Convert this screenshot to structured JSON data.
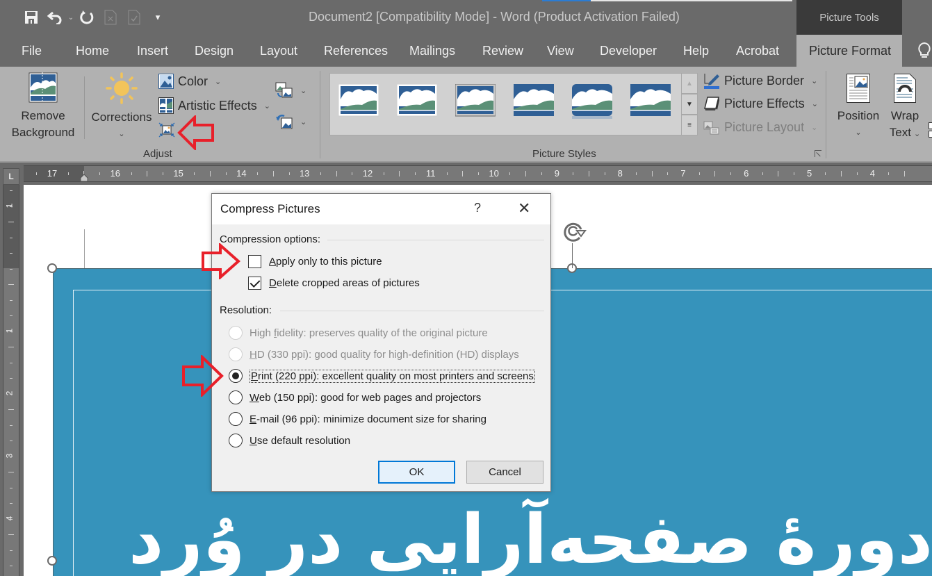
{
  "window": {
    "title": "Document2 [Compatibility Mode]  -  Word (Product Activation Failed)",
    "context_header": "Picture Tools",
    "quick_access": [
      {
        "icon": "save-icon",
        "glyph": "💾"
      },
      {
        "icon": "undo-icon",
        "glyph": "↶"
      },
      {
        "icon": "redo-icon",
        "glyph": "↻"
      },
      {
        "icon": "document-x-icon",
        "glyph": "🗋"
      },
      {
        "icon": "document-check-icon",
        "glyph": "🗋"
      },
      {
        "icon": "customize-qat-icon",
        "glyph": "▾"
      }
    ],
    "accent_color": "#2b7cd3"
  },
  "tabs": [
    {
      "label": "File"
    },
    {
      "label": "Home"
    },
    {
      "label": "Insert"
    },
    {
      "label": "Design"
    },
    {
      "label": "Layout"
    },
    {
      "label": "References"
    },
    {
      "label": "Mailings"
    },
    {
      "label": "Review"
    },
    {
      "label": "View"
    },
    {
      "label": "Developer"
    },
    {
      "label": "Help"
    },
    {
      "label": "Acrobat"
    },
    {
      "label": "Picture Format",
      "active": true
    }
  ],
  "ribbon": {
    "adjust": {
      "label": "Adjust",
      "remove_background_line1": "Remove",
      "remove_background_line2": "Background",
      "corrections": "Corrections",
      "color": "Color",
      "artistic_effects": "Artistic Effects"
    },
    "picture_styles": {
      "label": "Picture Styles",
      "picture_border": "Picture Border",
      "picture_effects": "Picture Effects",
      "picture_layout": "Picture Layout"
    },
    "arrange": {
      "position": "Position",
      "wrap_line1": "Wrap",
      "wrap_line2": "Text"
    }
  },
  "ruler": {
    "horizontal": [
      "17",
      "16",
      "15",
      "14",
      "13",
      "12",
      "11",
      "10",
      "9",
      "8",
      "7",
      "6",
      "5",
      "4"
    ],
    "vertical": [
      "1",
      "1",
      "2",
      "3",
      "4"
    ]
  },
  "document": {
    "heading": "دورهٔ صفحه‌آرایی در وُرد",
    "picture_color": "#3693bb"
  },
  "dialog": {
    "title": "Compress Pictures",
    "help": "?",
    "close": "✕",
    "compression_label": "Compression options:",
    "options": [
      {
        "pre": "",
        "u": "A",
        "post": "pply only to this picture",
        "checked": false
      },
      {
        "pre": "",
        "u": "D",
        "post": "elete cropped areas of pictures",
        "checked": true
      }
    ],
    "resolution_label": "Resolution:",
    "resolutions": [
      {
        "pre": "High ",
        "u": "f",
        "post": "idelity: preserves quality of the original picture",
        "disabled": true,
        "selected": false
      },
      {
        "pre": "",
        "u": "H",
        "post": "D (330 ppi): good quality for high-definition (HD) displays",
        "disabled": true,
        "selected": false
      },
      {
        "pre": "",
        "u": "P",
        "post": "rint (220 ppi): excellent quality on most printers and screens",
        "disabled": false,
        "selected": true
      },
      {
        "pre": "",
        "u": "W",
        "post": "eb (150 ppi): good for web pages and projectors",
        "disabled": false,
        "selected": false
      },
      {
        "pre": "",
        "u": "E",
        "post": "-mail (96 ppi): minimize document size for sharing",
        "disabled": false,
        "selected": false
      },
      {
        "pre": "",
        "u": "U",
        "post": "se default resolution",
        "disabled": false,
        "selected": false
      }
    ],
    "ok": "OK",
    "cancel": "Cancel"
  },
  "annotations": {
    "arrow_color": "#e8202a"
  }
}
